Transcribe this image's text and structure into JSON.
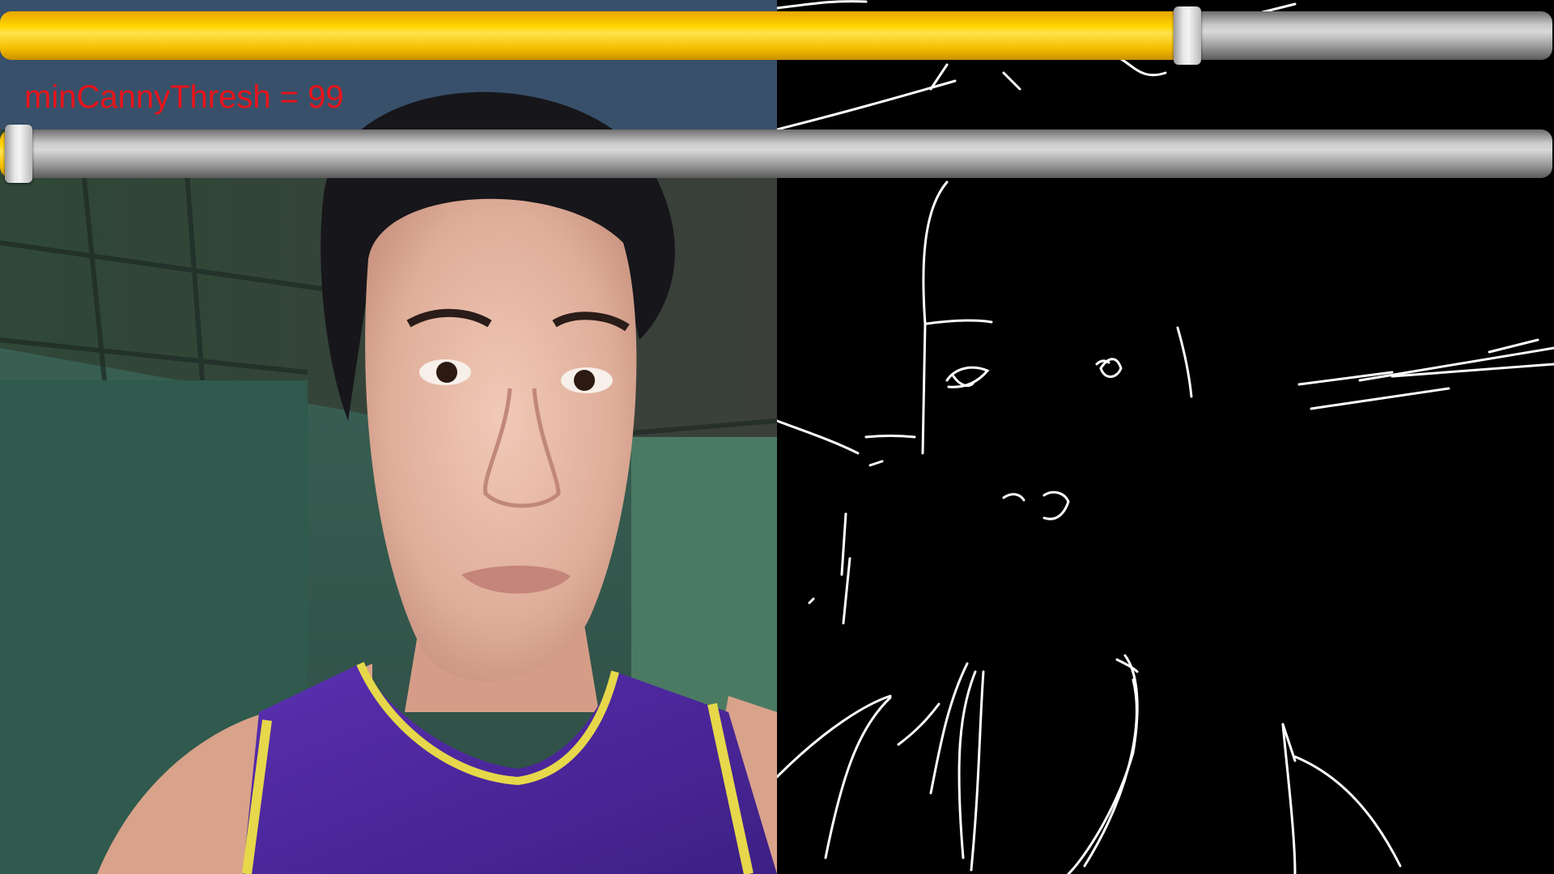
{
  "label": {
    "min_thresh_text": "minCannyThresh = 99"
  },
  "sliders": {
    "max_thresh": {
      "value_fraction": 0.765
    },
    "min_thresh": {
      "value_fraction": 0.012
    }
  },
  "colors": {
    "label": "#e8141a",
    "slider_fill": "#ffd400",
    "slider_track": "#a8a8a8",
    "edge_background": "#000000",
    "edge_lines": "#ffffff"
  },
  "icons": {
    "slider_thumb": "slider-thumb-handle"
  }
}
